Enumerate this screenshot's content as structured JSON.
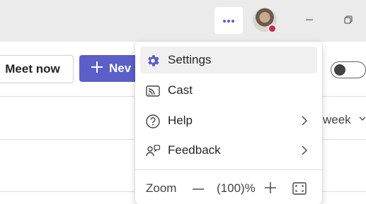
{
  "header": {
    "more_icon": "more-horizontal-icon",
    "avatar_status_color": "#c4314b",
    "minimize_icon": "minimize-icon",
    "restore_icon": "restore-icon"
  },
  "toolbar": {
    "meet_now_label": "Meet now",
    "new_label": "Nev",
    "new_icon": "plus-icon",
    "accent_color": "#5b5fc7"
  },
  "view": {
    "week_label": "week"
  },
  "menu": {
    "items": [
      {
        "label": "Settings",
        "icon": "gear-icon",
        "active": true
      },
      {
        "label": "Cast",
        "icon": "cast-icon"
      },
      {
        "label": "Help",
        "icon": "help-icon",
        "submenu": true
      },
      {
        "label": "Feedback",
        "icon": "feedback-icon",
        "submenu": true
      }
    ],
    "zoom": {
      "label": "Zoom",
      "value": "(100)%"
    }
  }
}
